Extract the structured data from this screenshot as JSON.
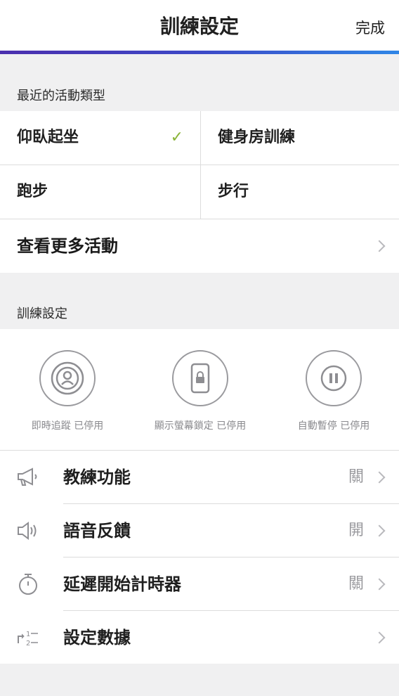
{
  "nav": {
    "title": "訓練設定",
    "done_label": "完成"
  },
  "recent": {
    "header": "最近的活動類型",
    "items": [
      {
        "label": "仰臥起坐",
        "selected": true
      },
      {
        "label": "健身房訓練",
        "selected": false
      },
      {
        "label": "跑步",
        "selected": false
      },
      {
        "label": "步行",
        "selected": false
      }
    ],
    "check_glyph": "✓",
    "more_label": "查看更多活動"
  },
  "training": {
    "header": "訓練設定",
    "toggles": [
      {
        "icon": "live-tracking-icon",
        "caption": "即時追蹤 已停用"
      },
      {
        "icon": "screen-lock-icon",
        "caption": "顯示螢幕鎖定 已停用"
      },
      {
        "icon": "auto-pause-icon",
        "caption": "自動暫停 已停用"
      }
    ],
    "rows": [
      {
        "icon": "megaphone-icon",
        "label": "教練功能",
        "value": "關"
      },
      {
        "icon": "speaker-icon",
        "label": "語音反饋",
        "value": "開"
      },
      {
        "icon": "stopwatch-icon",
        "label": "延遲開始計時器",
        "value": "關"
      },
      {
        "icon": "data-settings-icon",
        "label": "設定數據",
        "value": ""
      }
    ]
  },
  "colors": {
    "accent_start": "#4b2fae",
    "accent_end": "#2f86e6",
    "check": "#8ab438",
    "muted": "#9a9a9e"
  }
}
